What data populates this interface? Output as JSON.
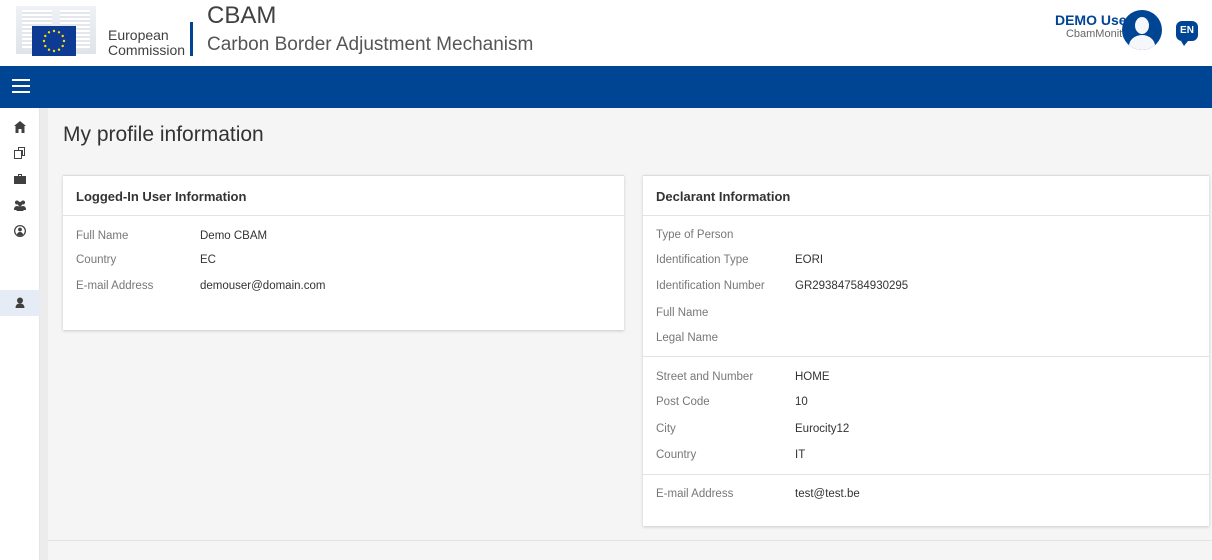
{
  "header": {
    "org_line1": "European",
    "org_line2": "Commission",
    "app_title": "CBAM",
    "app_subtitle": "Carbon Border Adjustment Mechanism",
    "user_name": "DEMO User",
    "user_role": "CbamMonitor",
    "language": "EN"
  },
  "colors": {
    "brand_blue": "#004494",
    "page_bg": "#f5f5f5"
  },
  "siderail": {
    "items": [
      {
        "icon": "home-icon"
      },
      {
        "icon": "documents-icon"
      },
      {
        "icon": "briefcase-icon"
      },
      {
        "icon": "users-icon"
      },
      {
        "icon": "user-circle-icon"
      },
      {
        "icon": "user-icon"
      }
    ]
  },
  "main": {
    "page_title": "My profile information",
    "user_card": {
      "title": "Logged-In User Information",
      "rows": [
        {
          "label": "Full Name",
          "value": "Demo CBAM"
        },
        {
          "label": "Country",
          "value": "EC"
        },
        {
          "label": "E-mail Address",
          "value": "demouser@domain.com"
        }
      ]
    },
    "declarant_card": {
      "title": "Declarant Information",
      "group1": [
        {
          "label": "Type of Person",
          "value": ""
        },
        {
          "label": "Identification Type",
          "value": "EORI"
        },
        {
          "label": "Identification Number",
          "value": "GR293847584930295"
        },
        {
          "label": "Full Name",
          "value": ""
        },
        {
          "label": "Legal Name",
          "value": ""
        }
      ],
      "group2": [
        {
          "label": "Street and Number",
          "value": "HOME"
        },
        {
          "label": "Post Code",
          "value": "10"
        },
        {
          "label": "City",
          "value": "Eurocity12"
        },
        {
          "label": "Country",
          "value": "IT"
        }
      ],
      "group3": [
        {
          "label": "E-mail Address",
          "value": "test@test.be"
        }
      ]
    }
  }
}
